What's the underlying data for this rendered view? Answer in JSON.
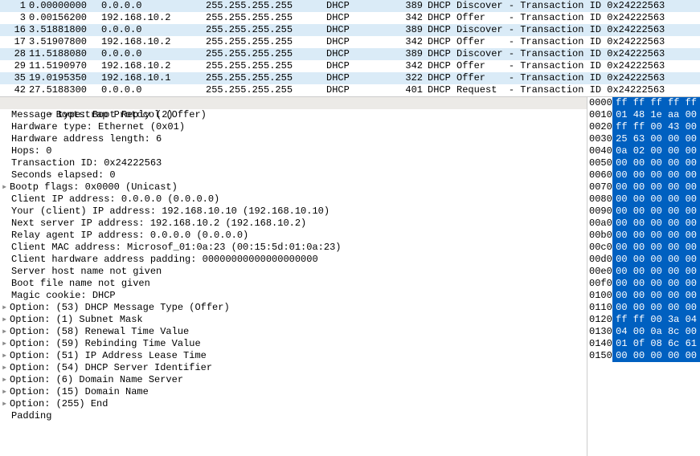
{
  "packets": [
    {
      "no": "1",
      "time": "0.00000000",
      "src": "0.0.0.0",
      "dst": "255.255.255.255",
      "proto": "DHCP",
      "len": "389",
      "info": "DHCP Discover - Transaction ID 0x24222563"
    },
    {
      "no": "3",
      "time": "0.00156200",
      "src": "192.168.10.2",
      "dst": "255.255.255.255",
      "proto": "DHCP",
      "len": "342",
      "info": "DHCP Offer    - Transaction ID 0x24222563"
    },
    {
      "no": "16",
      "time": "3.51881800",
      "src": "0.0.0.0",
      "dst": "255.255.255.255",
      "proto": "DHCP",
      "len": "389",
      "info": "DHCP Discover - Transaction ID 0x24222563"
    },
    {
      "no": "17",
      "time": "3.51907800",
      "src": "192.168.10.2",
      "dst": "255.255.255.255",
      "proto": "DHCP",
      "len": "342",
      "info": "DHCP Offer    - Transaction ID 0x24222563"
    },
    {
      "no": "28",
      "time": "11.5188080",
      "src": "0.0.0.0",
      "dst": "255.255.255.255",
      "proto": "DHCP",
      "len": "389",
      "info": "DHCP Discover - Transaction ID 0x24222563"
    },
    {
      "no": "29",
      "time": "11.5190970",
      "src": "192.168.10.2",
      "dst": "255.255.255.255",
      "proto": "DHCP",
      "len": "342",
      "info": "DHCP Offer    - Transaction ID 0x24222563"
    },
    {
      "no": "35",
      "time": "19.0195350",
      "src": "192.168.10.1",
      "dst": "255.255.255.255",
      "proto": "DHCP",
      "len": "322",
      "info": "DHCP Offer    - Transaction ID 0x24222563"
    },
    {
      "no": "42",
      "time": "27.5188300",
      "src": "0.0.0.0",
      "dst": "255.255.255.255",
      "proto": "DHCP",
      "len": "401",
      "info": "DHCP Request  - Transaction ID 0x24222563"
    }
  ],
  "tree_root": "Bootstrap Protocol (Offer)",
  "tree": [
    {
      "t": "Message type: Boot Reply (2)",
      "e": " "
    },
    {
      "t": "Hardware type: Ethernet (0x01)",
      "e": " "
    },
    {
      "t": "Hardware address length: 6",
      "e": " "
    },
    {
      "t": "Hops: 0",
      "e": " "
    },
    {
      "t": "Transaction ID: 0x24222563",
      "e": " "
    },
    {
      "t": "Seconds elapsed: 0",
      "e": " "
    },
    {
      "t": "Bootp flags: 0x0000 (Unicast)",
      "e": "▸"
    },
    {
      "t": "Client IP address: 0.0.0.0 (0.0.0.0)",
      "e": " "
    },
    {
      "t": "Your (client) IP address: 192.168.10.10 (192.168.10.10)",
      "e": " "
    },
    {
      "t": "Next server IP address: 192.168.10.2 (192.168.10.2)",
      "e": " "
    },
    {
      "t": "Relay agent IP address: 0.0.0.0 (0.0.0.0)",
      "e": " "
    },
    {
      "t": "Client MAC address: Microsof_01:0a:23 (00:15:5d:01:0a:23)",
      "e": " "
    },
    {
      "t": "Client hardware address padding: 00000000000000000000",
      "e": " "
    },
    {
      "t": "Server host name not given",
      "e": " "
    },
    {
      "t": "Boot file name not given",
      "e": " "
    },
    {
      "t": "Magic cookie: DHCP",
      "e": " "
    },
    {
      "t": "Option: (53) DHCP Message Type (Offer)",
      "e": "▸"
    },
    {
      "t": "Option: (1) Subnet Mask",
      "e": "▸"
    },
    {
      "t": "Option: (58) Renewal Time Value",
      "e": "▸"
    },
    {
      "t": "Option: (59) Rebinding Time Value",
      "e": "▸"
    },
    {
      "t": "Option: (51) IP Address Lease Time",
      "e": "▸"
    },
    {
      "t": "Option: (54) DHCP Server Identifier",
      "e": "▸"
    },
    {
      "t": "Option: (6) Domain Name Server",
      "e": "▸"
    },
    {
      "t": "Option: (15) Domain Name",
      "e": "▸"
    },
    {
      "t": "Option: (255) End",
      "e": "▸"
    },
    {
      "t": "Padding",
      "e": " "
    }
  ],
  "hex": [
    {
      "off": "0000",
      "b": "ff ff ff ff ff"
    },
    {
      "off": "0010",
      "b": "01 48 1e aa 00"
    },
    {
      "off": "0020",
      "b": "ff ff 00 43 00"
    },
    {
      "off": "0030",
      "b": "25 63 00 00 00"
    },
    {
      "off": "0040",
      "b": "0a 02 00 00 00"
    },
    {
      "off": "0050",
      "b": "00 00 00 00 00"
    },
    {
      "off": "0060",
      "b": "00 00 00 00 00"
    },
    {
      "off": "0070",
      "b": "00 00 00 00 00"
    },
    {
      "off": "0080",
      "b": "00 00 00 00 00"
    },
    {
      "off": "0090",
      "b": "00 00 00 00 00"
    },
    {
      "off": "00a0",
      "b": "00 00 00 00 00"
    },
    {
      "off": "00b0",
      "b": "00 00 00 00 00"
    },
    {
      "off": "00c0",
      "b": "00 00 00 00 00"
    },
    {
      "off": "00d0",
      "b": "00 00 00 00 00"
    },
    {
      "off": "00e0",
      "b": "00 00 00 00 00"
    },
    {
      "off": "00f0",
      "b": "00 00 00 00 00"
    },
    {
      "off": "0100",
      "b": "00 00 00 00 00"
    },
    {
      "off": "0110",
      "b": "00 00 00 00 00"
    },
    {
      "off": "0120",
      "b": "ff ff 00 3a 04"
    },
    {
      "off": "0130",
      "b": "04 00 0a 8c 00"
    },
    {
      "off": "0140",
      "b": "01 0f 08 6c 61"
    },
    {
      "off": "0150",
      "b": "00 00 00 00 00"
    }
  ]
}
